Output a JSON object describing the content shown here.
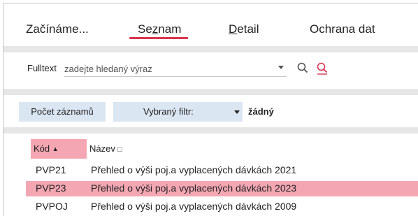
{
  "tabs": [
    {
      "pre": "Začínáme",
      "acc": "",
      "post": "...",
      "full": "Začínáme..."
    },
    {
      "pre": "Se",
      "acc": "z",
      "post": "nam",
      "full": "Seznam"
    },
    {
      "pre": "",
      "acc": "D",
      "post": "etail",
      "full": "Detail"
    },
    {
      "pre": "Ochrana dat",
      "acc": "",
      "post": "",
      "full": "Ochrana dat"
    }
  ],
  "active_tab": "Seznam",
  "search": {
    "label": "Fulltext",
    "placeholder": "zadejte hledaný výraz"
  },
  "toolbar": {
    "count_button": "Počet záznamů",
    "filter_label": "Vybraný filtr:",
    "filter_value": "žádný"
  },
  "table": {
    "columns": [
      {
        "label": "Kód",
        "sort_indicator": "▲"
      },
      {
        "label": "Název",
        "sort_indicator": "□"
      }
    ],
    "rows": [
      {
        "kod": "PVP21",
        "nazev": "Přehled o výši poj.a vyplacených dávkách 2021",
        "selected": false
      },
      {
        "kod": "PVP23",
        "nazev": "Přehled o výši poj.a vyplacených dávkách 2023",
        "selected": true
      },
      {
        "kod": "PVPOJ",
        "nazev": "Přehled o výši poj.a vyplacených dávkách 2009",
        "selected": false
      }
    ]
  },
  "colors": {
    "accent": "#d9364f",
    "selection": "#f4a7b3",
    "button_bg": "#dbe6f3",
    "separator": "#e6e6e6"
  },
  "icons": [
    "search-icon",
    "advanced-search-icon",
    "chevron-down-icon"
  ]
}
